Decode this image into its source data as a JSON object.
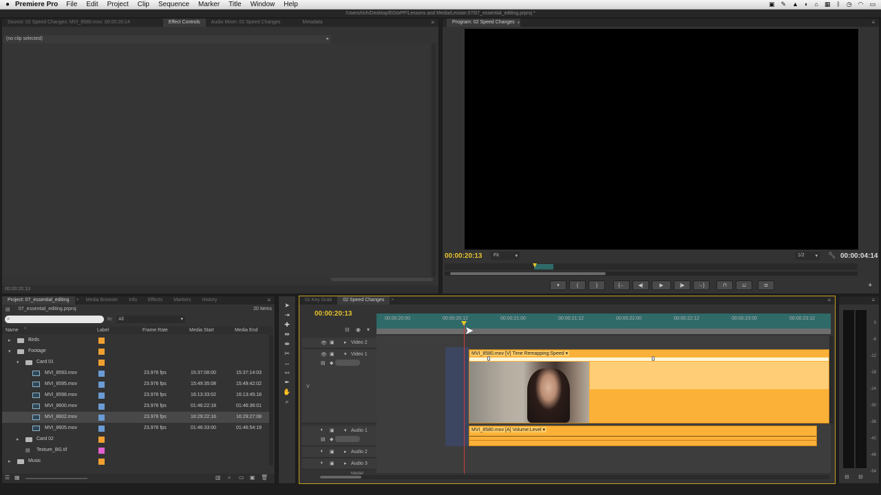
{
  "menubar": {
    "app_name": "Premiere Pro",
    "items": [
      "File",
      "Edit",
      "Project",
      "Clip",
      "Sequence",
      "Marker",
      "Title",
      "Window",
      "Help"
    ]
  },
  "window_title": "/Users/rich/Desktop/EGtoPP/Lessons and Media/Lesson 07/07_essential_editing.prproj *",
  "source_panel": {
    "tabs": [
      "Source: 02 Speed Changes: MVI_8580.mov: 00:00:20:14",
      "Effect Controls",
      "Audio Mixer: 02 Speed Changes",
      "Metadata"
    ],
    "active_tab": "Effect Controls",
    "no_clip_text": "(no clip selected)",
    "bottom_timecode": "00:00:20:13"
  },
  "program_monitor": {
    "tab_label": "Program: 02 Speed Changes",
    "current_timecode": "00:00:20:13",
    "zoom_label": "Fit",
    "resolution_label": "1/2",
    "duration_timecode": "00:00:04:14"
  },
  "project_panel": {
    "tabs": [
      "Project: 07_essential_editing",
      "Media Browser",
      "Info",
      "Effects",
      "Markers",
      "History"
    ],
    "active_tab": "Project: 07_essential_editing",
    "project_file": "07_essential_editing.prproj",
    "item_count": "20 Items",
    "in_label": "In:",
    "in_value": "All",
    "columns": [
      "Name",
      "Label",
      "Frame Rate",
      "Media Start",
      "Media End"
    ],
    "rows": [
      {
        "name": "Birds",
        "kind": "folder",
        "indent": 1,
        "expanded": false,
        "label_color": "#f0a030",
        "fps": "",
        "start": "",
        "end": ""
      },
      {
        "name": "Footage",
        "kind": "folder",
        "indent": 1,
        "expanded": true,
        "label_color": "#f0a030",
        "fps": "",
        "start": "",
        "end": ""
      },
      {
        "name": "Card 01",
        "kind": "folder",
        "indent": 2,
        "expanded": true,
        "label_color": "#f0a030",
        "fps": "",
        "start": "",
        "end": ""
      },
      {
        "name": "MVI_8593.mov",
        "kind": "clip",
        "indent": 3,
        "label_color": "#6a9bd4",
        "fps": "23.976 fps",
        "start": "15:37:08:00",
        "end": "15:37:14:03"
      },
      {
        "name": "MVI_8595.mov",
        "kind": "clip",
        "indent": 3,
        "label_color": "#6a9bd4",
        "fps": "23.976 fps",
        "start": "15:49:35:08",
        "end": "15:49:42:02"
      },
      {
        "name": "MVI_8598.mov",
        "kind": "clip",
        "indent": 3,
        "label_color": "#6a9bd4",
        "fps": "23.976 fps",
        "start": "16:13:33:02",
        "end": "16:13:45:18"
      },
      {
        "name": "MVI_8600.mov",
        "kind": "clip",
        "indent": 3,
        "label_color": "#6a9bd4",
        "fps": "23.976 fps",
        "start": "01:46:22:18",
        "end": "01:46:36:01"
      },
      {
        "name": "MVI_8602.mov",
        "kind": "clip",
        "indent": 3,
        "label_color": "#6a9bd4",
        "fps": "23.976 fps",
        "start": "16:29:22:16",
        "end": "16:29:27:08",
        "selected": true
      },
      {
        "name": "MVI_8605.mov",
        "kind": "clip",
        "indent": 3,
        "label_color": "#6a9bd4",
        "fps": "23.976 fps",
        "start": "01:46:33:00",
        "end": "01:46:54:19"
      },
      {
        "name": "Card 02",
        "kind": "folder",
        "indent": 2,
        "expanded": false,
        "label_color": "#f0a030",
        "fps": "",
        "start": "",
        "end": ""
      },
      {
        "name": "Texture_BG.tif",
        "kind": "image",
        "indent": 2,
        "label_color": "#e060d0",
        "fps": "",
        "start": "",
        "end": ""
      },
      {
        "name": "Music",
        "kind": "folder",
        "indent": 1,
        "expanded": false,
        "label_color": "#f0a030",
        "fps": "",
        "start": "",
        "end": ""
      }
    ]
  },
  "timeline": {
    "tabs": [
      "01 Key Grab",
      "02 Speed Changes"
    ],
    "active_tab": "02 Speed Changes",
    "timecode": "00:00:20:13",
    "ruler_labels": [
      "00:00:20:00",
      "00:00:20:12",
      "00:00:21:00",
      "00:00:21:12",
      "00:00:22:00",
      "00:00:22:12",
      "00:00:23:00",
      "00:00:23:12"
    ],
    "tracks": {
      "video2": "Video 2",
      "video1": "Video 1",
      "audio1": "Audio 1",
      "audio2": "Audio 2",
      "audio3": "Audio 3",
      "master": "Master"
    },
    "video_clip_label": "MVI_8580.mov [V]  Time Remapping:Speed ▾",
    "audio_clip_label": "MVI_8580.mov [A]  Volume:Level ▾",
    "target_v": "V",
    "target_a": "A1"
  },
  "audio_meter": {
    "labels": [
      "0",
      "-6",
      "-12",
      "-18",
      "-24",
      "-30",
      "-36",
      "-42",
      "-48",
      "-54"
    ]
  },
  "colors": {
    "accent_yellow": "#e6c32d",
    "clip_orange": "#fbb138",
    "clip_orange_light": "#ffcc66",
    "teal_bar": "#2f6a69"
  }
}
